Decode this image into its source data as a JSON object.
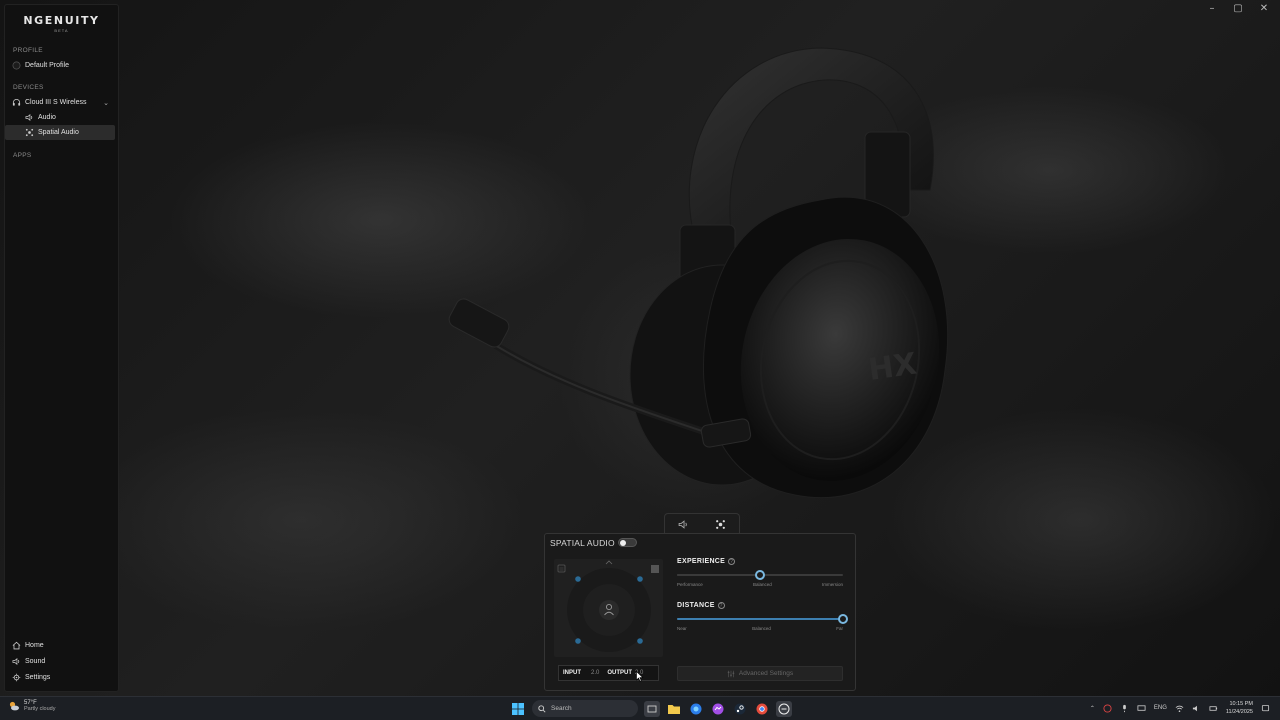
{
  "window": {
    "minimize": "–",
    "maximize": "▢",
    "close": "✕"
  },
  "app": {
    "name": "NGENUITY",
    "tag": "BETA"
  },
  "sidebar": {
    "profile_heading": "PROFILE",
    "profile_item": "Default Profile",
    "devices_heading": "DEVICES",
    "device_name": "Cloud III S Wireless",
    "device_items": [
      {
        "label": "Audio",
        "icon": "speaker-icon",
        "active": false
      },
      {
        "label": "Spatial Audio",
        "icon": "spatial-audio-icon",
        "active": true
      }
    ],
    "apps_heading": "APPS",
    "bottom_items": [
      {
        "label": "Home",
        "icon": "home-icon"
      },
      {
        "label": "Sound",
        "icon": "speaker-icon"
      },
      {
        "label": "Settings",
        "icon": "gear-icon"
      }
    ]
  },
  "panel": {
    "title": "SPATIAL AUDIO",
    "toggle_on": false,
    "input_label": "INPUT",
    "input_value": "2.0",
    "output_label": "OUTPUT",
    "output_value": "2.0",
    "experience": {
      "title": "EXPERIENCE",
      "marks": [
        "Performance",
        "Balanced",
        "Immersion"
      ],
      "value": 0.5
    },
    "distance": {
      "title": "DISTANCE",
      "marks": [
        "Near",
        "Balanced",
        "Far"
      ],
      "value": 1.0
    },
    "advanced_label": "Advanced Settings"
  },
  "taskbar": {
    "weather_temp": "57°F",
    "weather_desc": "Partly cloudy",
    "search_placeholder": "Search",
    "lang": "ENG",
    "time": "10:15 PM",
    "date": "11/24/2025"
  },
  "colors": {
    "accent": "#7ab8e0",
    "fill": "#3d7fb0",
    "sidebar_bg": "#111111",
    "panel_bg": "#1a1a1a"
  }
}
